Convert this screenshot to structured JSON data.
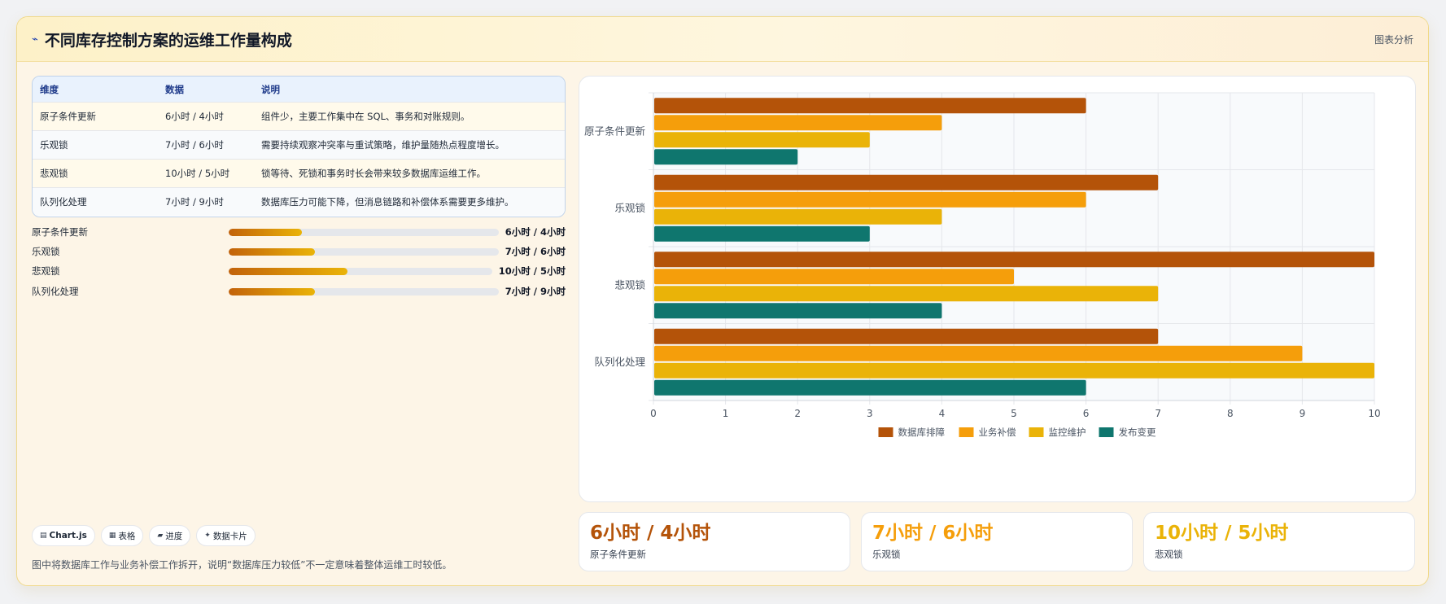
{
  "header": {
    "title": "不同库存控制方案的运维工作量构成",
    "tag": "图表分析"
  },
  "table": {
    "columns": [
      "维度",
      "数据",
      "说明"
    ],
    "rows": [
      {
        "name": "原子条件更新",
        "data": "6小时 / 4小时",
        "desc": "组件少，主要工作集中在 SQL、事务和对账规则。"
      },
      {
        "name": "乐观锁",
        "data": "7小时 / 6小时",
        "desc": "需要持续观察冲突率与重试策略，维护量随热点程度增长。"
      },
      {
        "name": "悲观锁",
        "data": "10小时 / 5小时",
        "desc": "锁等待、死锁和事务时长会带来较多数据库运维工作。"
      },
      {
        "name": "队列化处理",
        "data": "7小时 / 9小时",
        "desc": "数据库压力可能下降，但消息链路和补偿体系需要更多维护。"
      }
    ]
  },
  "progress": [
    {
      "label": "原子条件更新",
      "value": "6小时 / 4小时",
      "level": 0.27
    },
    {
      "label": "乐观锁",
      "value": "7小时 / 6小时",
      "level": 0.32
    },
    {
      "label": "悲观锁",
      "value": "10小时 / 5小时",
      "level": 0.45
    },
    {
      "label": "队列化处理",
      "value": "7小时 / 9小时",
      "level": 0.32
    }
  ],
  "pills": [
    {
      "icon": "▤",
      "label": "Chart.js"
    },
    {
      "icon": "▦",
      "label": "表格"
    },
    {
      "icon": "▰",
      "label": "进度"
    },
    {
      "icon": "✦",
      "label": "数据卡片"
    }
  ],
  "note": "图中将数据库工作与业务补偿工作拆开，说明“数据库压力较低”不一定意味着整体运维工时较低。",
  "stats": [
    {
      "value": "6小时 / 4小时",
      "label": "原子条件更新",
      "color": "#b45309"
    },
    {
      "value": "7小时 / 6小时",
      "label": "乐观锁",
      "color": "#f59e0b"
    },
    {
      "value": "10小时 / 5小时",
      "label": "悲观锁",
      "color": "#eab308"
    }
  ],
  "chart_data": {
    "type": "bar",
    "orientation": "horizontal",
    "categories": [
      "原子条件更新",
      "乐观锁",
      "悲观锁",
      "队列化处理"
    ],
    "series": [
      {
        "name": "数据库排障",
        "color": "#b45309",
        "values": [
          6,
          7,
          10,
          7
        ]
      },
      {
        "name": "业务补偿",
        "color": "#f59e0b",
        "values": [
          4,
          6,
          5,
          9
        ]
      },
      {
        "name": "监控维护",
        "color": "#eab308",
        "values": [
          3,
          4,
          7,
          10
        ]
      },
      {
        "name": "发布变更",
        "color": "#0f766e",
        "values": [
          2,
          3,
          4,
          6
        ]
      }
    ],
    "xlim": [
      0,
      10
    ],
    "xticks": [
      "0",
      "1",
      "2",
      "3",
      "4",
      "5",
      "6",
      "7",
      "8",
      "9",
      "10"
    ],
    "grid": true,
    "legend": "bottom"
  }
}
